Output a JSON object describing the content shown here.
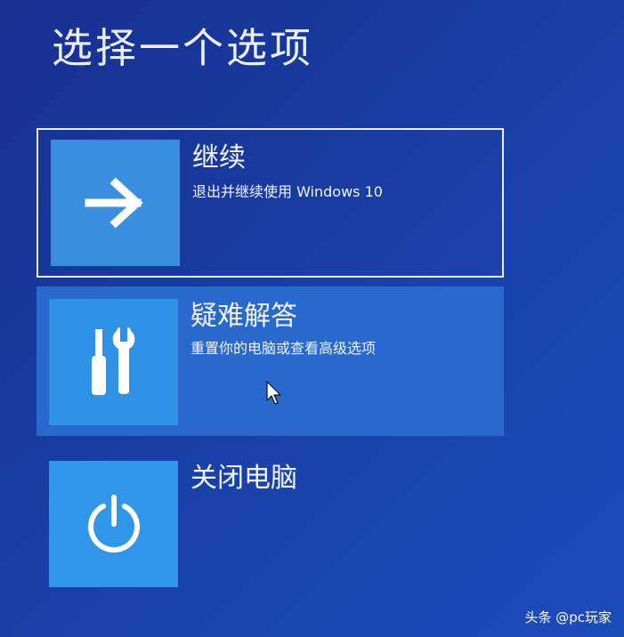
{
  "page": {
    "title": "选择一个选项"
  },
  "options": [
    {
      "title": "继续",
      "description": "退出并继续使用 Windows 10",
      "icon": "arrow-right-icon"
    },
    {
      "title": "疑难解答",
      "description": "重置你的电脑或查看高级选项",
      "icon": "tools-icon"
    },
    {
      "title": "关闭电脑",
      "description": "",
      "icon": "power-icon"
    }
  ],
  "watermark": {
    "text": "头条 @pc玩家"
  },
  "colors": {
    "background": "#1a3a9f",
    "tile": "#2f92e6",
    "selected_row": "#2968cc",
    "focus_border": "#e6ecfa"
  }
}
